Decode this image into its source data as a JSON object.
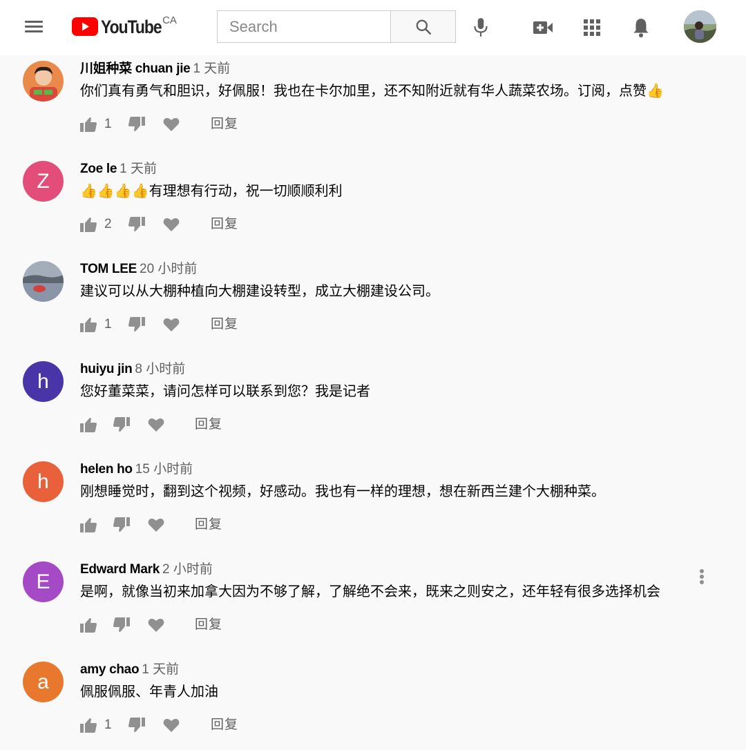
{
  "header": {
    "logo_text": "YouTube",
    "country": "CA",
    "search_placeholder": "Search",
    "icons": [
      "menu-icon",
      "search-icon",
      "mic-icon",
      "create-video-icon",
      "apps-icon",
      "bell-icon"
    ],
    "brand_color": "#ff0000"
  },
  "comments": [
    {
      "author": "川姐种菜 chuan jie",
      "time": "1 天前",
      "text": "你们真有勇气和胆识，好佩服！我也在卡尔加里，还不知附近就有华人蔬菜农场。订阅，点赞👍",
      "likes": "1",
      "reply": "回复",
      "avatar_letter": "",
      "avatar_color": "#e98a4a"
    },
    {
      "author": "Zoe le",
      "time": "1 天前",
      "text": "👍👍👍👍有理想有行动，祝一切顺顺利利",
      "likes": "2",
      "reply": "回复",
      "avatar_letter": "Z",
      "avatar_color": "#e24d7a"
    },
    {
      "author": "TOM LEE",
      "time": "20 小时前",
      "text": "建议可以从大棚种植向大棚建设转型，成立大棚建设公司。",
      "likes": "1",
      "reply": "回复",
      "avatar_letter": "",
      "avatar_color": "#8a96a8"
    },
    {
      "author": "huiyu jin",
      "time": "8 小时前",
      "text": "您好董菜菜，请问怎样可以联系到您？我是记者",
      "likes": "",
      "reply": "回复",
      "avatar_letter": "h",
      "avatar_color": "#4a35a8"
    },
    {
      "author": "helen ho",
      "time": "15 小时前",
      "text": "刚想睡觉时，翻到这个视频，好感动。我也有一样的理想，想在新西兰建个大棚种菜。",
      "likes": "",
      "reply": "回复",
      "avatar_letter": "h",
      "avatar_color": "#e8613a"
    },
    {
      "author": "Edward Mark",
      "time": "2 小时前",
      "text": "是啊，就像当初来加拿大因为不够了解，了解绝不会来，既来之则安之，还年轻有很多选择机会",
      "likes": "",
      "reply": "回复",
      "avatar_letter": "E",
      "avatar_color": "#a44ac4"
    },
    {
      "author": "amy chao",
      "time": "1 天前",
      "text": "佩服佩服、年青人加油",
      "likes": "1",
      "reply": "回复",
      "avatar_letter": "a",
      "avatar_color": "#e8782e"
    }
  ]
}
